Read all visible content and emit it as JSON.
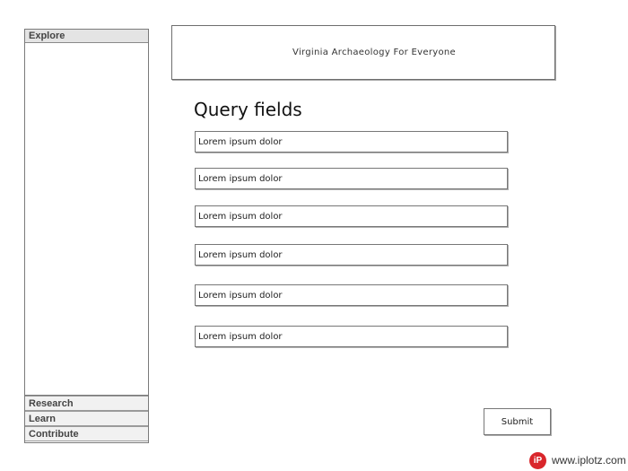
{
  "sidebar": {
    "sections": [
      {
        "label": "Explore"
      },
      {
        "label": "Research"
      },
      {
        "label": "Learn"
      },
      {
        "label": "Contribute"
      }
    ]
  },
  "header": {
    "title": "Virginia Archaeology For Everyone"
  },
  "main": {
    "title": "Query fields",
    "fields": [
      {
        "placeholder": "Lorem ipsum dolor"
      },
      {
        "placeholder": "Lorem ipsum dolor"
      },
      {
        "placeholder": "Lorem ipsum dolor"
      },
      {
        "placeholder": "Lorem ipsum dolor"
      },
      {
        "placeholder": "Lorem ipsum dolor"
      },
      {
        "placeholder": "Lorem ipsum dolor"
      }
    ],
    "submit_label": "Submit"
  },
  "watermark": {
    "logo_text": "iP",
    "site": "www.iplotz.com",
    "logo_color": "#d9262b"
  }
}
